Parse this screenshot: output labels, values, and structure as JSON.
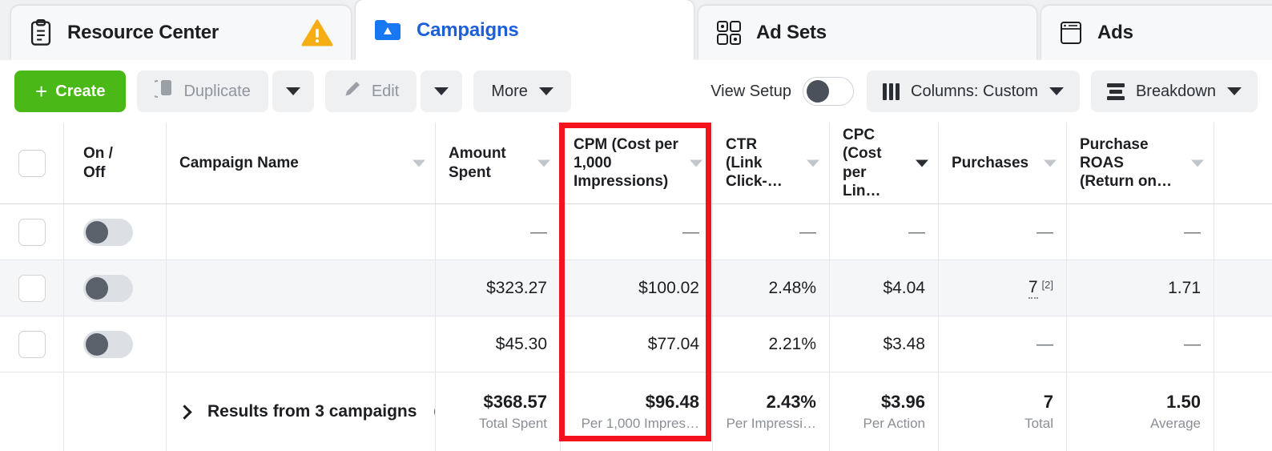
{
  "tabs": [
    {
      "id": "resource",
      "label": "Resource Center",
      "icon": "clipboard-icon",
      "active": false,
      "warning": true
    },
    {
      "id": "campaigns",
      "label": "Campaigns",
      "icon": "folder-campaign-icon",
      "active": true,
      "warning": false
    },
    {
      "id": "adsets",
      "label": "Ad Sets",
      "icon": "grid-squares-icon",
      "active": false,
      "warning": false
    },
    {
      "id": "ads",
      "label": "Ads",
      "icon": "window-icon",
      "active": false,
      "warning": false
    }
  ],
  "toolbar": {
    "create_label": "Create",
    "create_plus": "+",
    "duplicate_label": "Duplicate",
    "edit_label": "Edit",
    "more_label": "More",
    "view_setup_label": "View Setup",
    "view_setup_on": false,
    "columns_label": "Columns: Custom",
    "breakdown_label": "Breakdown"
  },
  "colors": {
    "create_green": "#4ab816",
    "active_tab_blue": "#1b5fd9",
    "warning_amber": "#f5ad14",
    "highlight_red": "#f6121d",
    "alt_row": "#f5f6f7"
  },
  "table": {
    "headers": {
      "on_off": "On / Off",
      "campaign_name": "Campaign Name",
      "amount_spent": "Amount Spent",
      "cpm": "CPM (Cost per 1,000 Impressions)",
      "ctr": "CTR (Link Click-…",
      "cpc": "CPC (Cost per Lin…",
      "purchases": "Purchases",
      "roas": "Purchase ROAS (Return on…"
    },
    "rows": [
      {
        "campaign_name": "",
        "toggle_on": false,
        "amount_spent": "—",
        "cpm": "—",
        "ctr": "—",
        "cpc": "—",
        "purchases": "—",
        "purchases_footnote": "",
        "roas": "—"
      },
      {
        "campaign_name": "",
        "toggle_on": false,
        "amount_spent": "$323.27",
        "cpm": "$100.02",
        "ctr": "2.48%",
        "cpc": "$4.04",
        "purchases": "7",
        "purchases_footnote": "[2]",
        "roas": "1.71"
      },
      {
        "campaign_name": "",
        "toggle_on": false,
        "amount_spent": "$45.30",
        "cpm": "$77.04",
        "ctr": "2.21%",
        "cpc": "$3.48",
        "purchases": "—",
        "purchases_footnote": "",
        "roas": "—"
      }
    ],
    "totals": {
      "label": "Results from 3 campaigns",
      "amount_spent_value": "$368.57",
      "amount_spent_sub": "Total Spent",
      "cpm_value": "$96.48",
      "cpm_sub": "Per 1,000 Impres…",
      "ctr_value": "2.43%",
      "ctr_sub": "Per Impressi…",
      "cpc_value": "$3.96",
      "cpc_sub": "Per Action",
      "purchases_value": "7",
      "purchases_sub": "Total",
      "roas_value": "1.50",
      "roas_sub": "Average"
    }
  },
  "annotation": {
    "highlight_column": "CPM (Cost per 1,000 Impressions)"
  }
}
